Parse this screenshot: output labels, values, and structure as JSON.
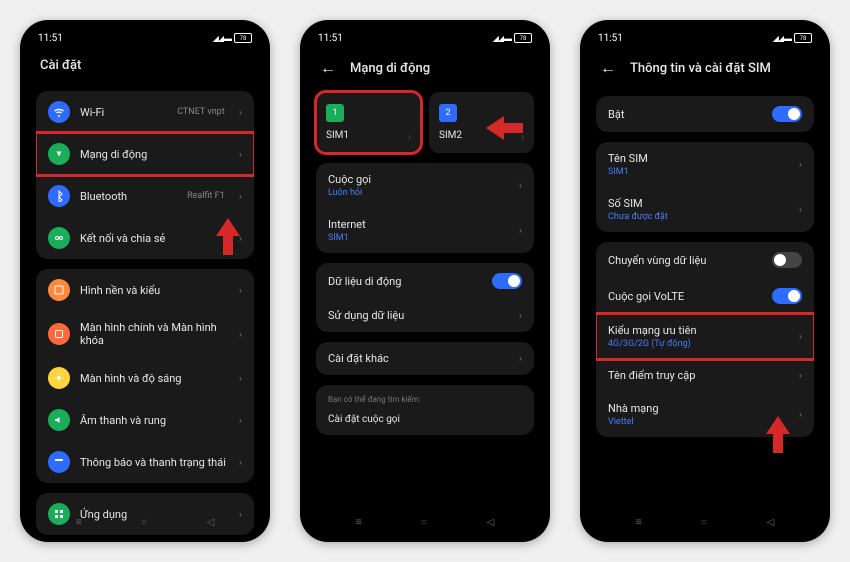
{
  "status": {
    "time": "11:51",
    "battery": "78"
  },
  "phone1": {
    "title": "Cài đặt",
    "group1": [
      {
        "label": "Wi-Fi",
        "value": "CTNET vnpt",
        "color": "#2d6cff",
        "icon": "wifi"
      },
      {
        "label": "Mạng di động",
        "value": "",
        "color": "#1aad5a",
        "icon": "cell",
        "hl": true
      },
      {
        "label": "Bluetooth",
        "value": "Realfit F1",
        "color": "#2d6cff",
        "icon": "bt"
      },
      {
        "label": "Kết nối và chia sẻ",
        "value": "",
        "color": "#1aad5a",
        "icon": "link"
      }
    ],
    "group2": [
      {
        "label": "Hình nền và kiểu",
        "color": "#ff8a3d",
        "icon": "wall"
      },
      {
        "label": "Màn hình chính và Màn hình khóa",
        "color": "#ff6a3d",
        "icon": "home"
      },
      {
        "label": "Màn hình và độ sáng",
        "color": "#ffd43d",
        "icon": "sun"
      },
      {
        "label": "Âm thanh và rung",
        "color": "#1aad5a",
        "icon": "sound"
      },
      {
        "label": "Thông báo và thanh trạng thái",
        "color": "#2d6cff",
        "icon": "notif"
      }
    ],
    "group3": [
      {
        "label": "Ứng dụng",
        "color": "#1aad5a",
        "icon": "apps"
      }
    ]
  },
  "phone2": {
    "title": "Mạng di động",
    "sims": [
      {
        "num": "1",
        "label": "SIM1",
        "color": "#1aad5a",
        "hl": true
      },
      {
        "num": "2",
        "label": "SIM2",
        "color": "#2d6cff"
      }
    ],
    "defaults": [
      {
        "label": "Cuộc gọi",
        "value": "Luôn hỏi"
      },
      {
        "label": "Internet",
        "value": "SIM1"
      }
    ],
    "data": [
      {
        "label": "Dữ liệu di động",
        "toggle": true
      },
      {
        "label": "Sử dụng dữ liệu"
      }
    ],
    "other": {
      "label": "Cài đặt khác"
    },
    "hint": "Bạn có thể đang tìm kiếm:",
    "hint_item": "Cài đặt cuộc gọi"
  },
  "phone3": {
    "title": "Thông tin và cài đặt SIM",
    "enable": {
      "label": "Bật",
      "toggle": true
    },
    "info": [
      {
        "label": "Tên SIM",
        "value": "SIM1"
      },
      {
        "label": "Số SIM",
        "value": "Chưa được đặt"
      }
    ],
    "switches": [
      {
        "label": "Chuyển vùng dữ liệu",
        "toggle": false
      },
      {
        "label": "Cuộc gọi VoLTE",
        "toggle": true
      },
      {
        "label": "Kiểu mạng ưu tiên",
        "value": "4G/3G/2G (Tự động)",
        "hl": true
      },
      {
        "label": "Tên điểm truy cập"
      },
      {
        "label": "Nhà mạng",
        "value": "Viettel"
      }
    ]
  }
}
